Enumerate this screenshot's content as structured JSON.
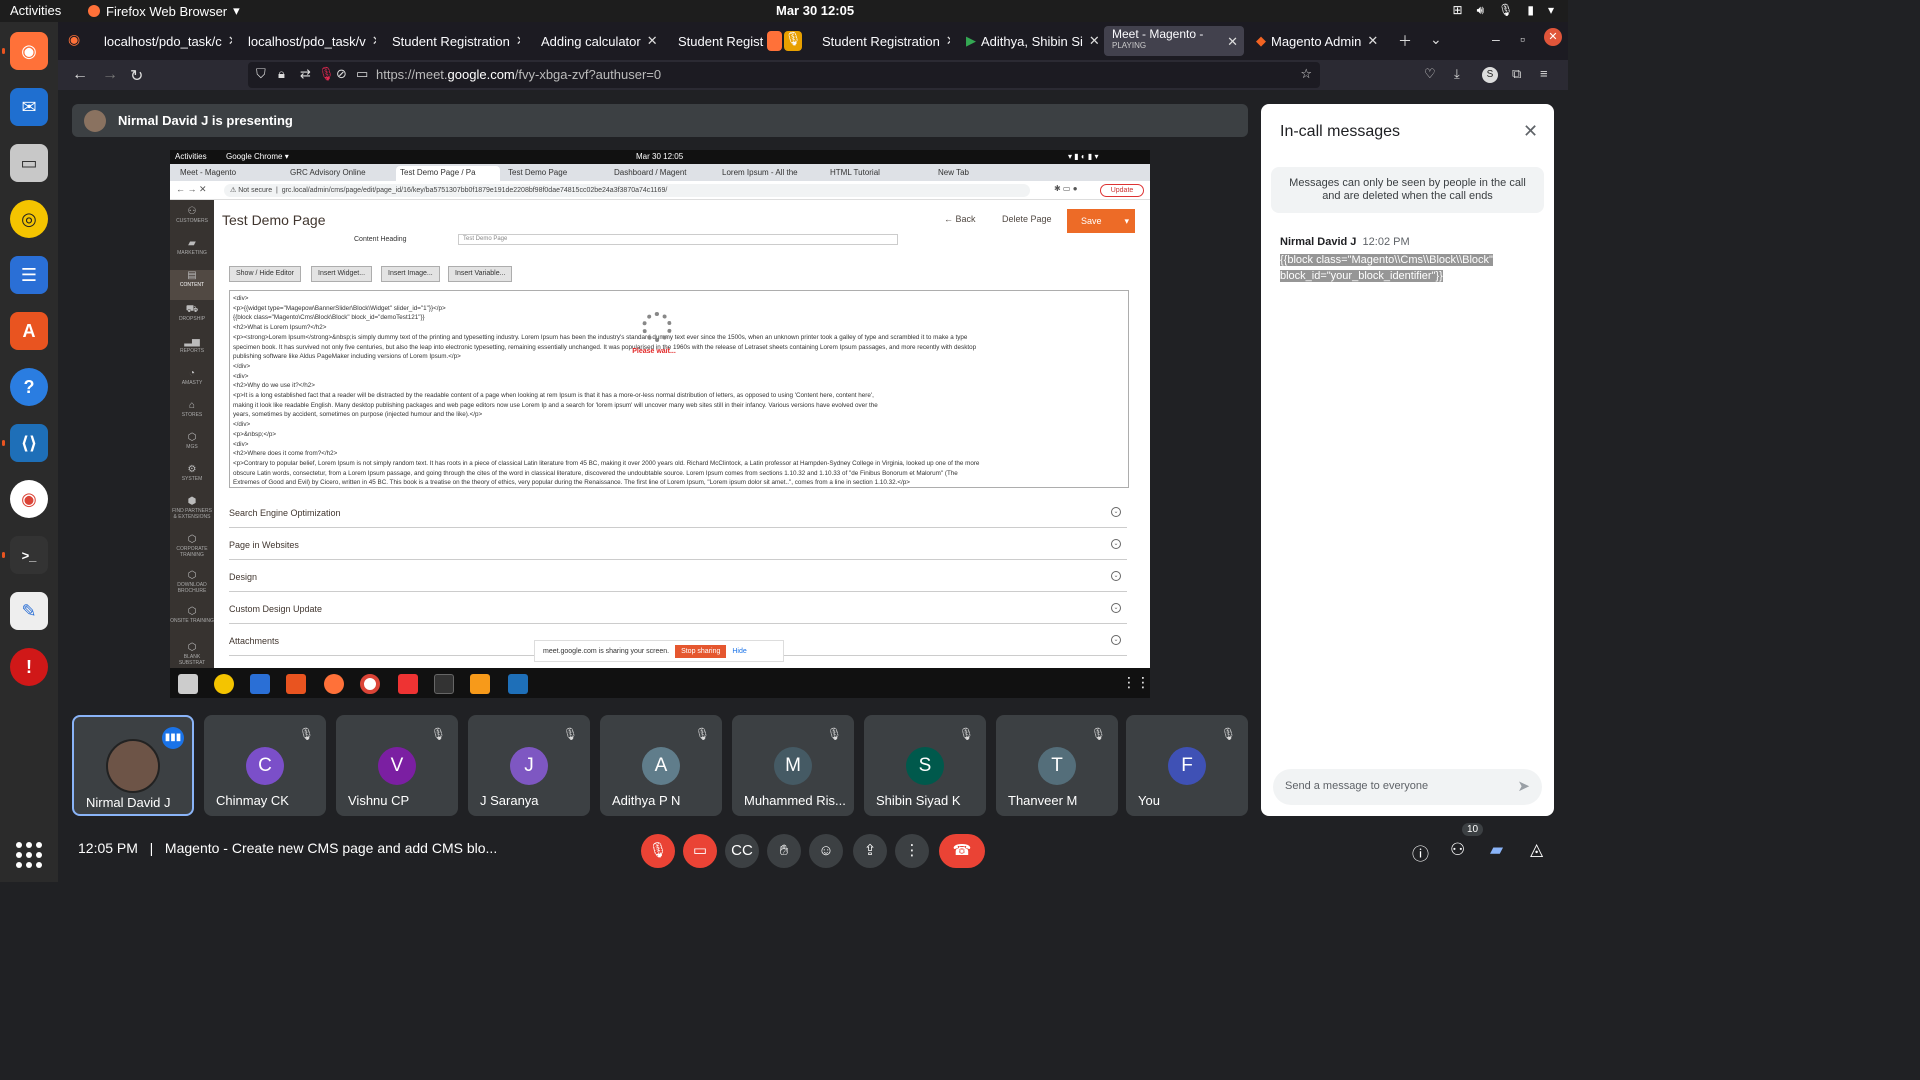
{
  "system_bar": {
    "activities": "Activities",
    "app_name": "Firefox Web Browser",
    "clock": "Mar 30  12:05"
  },
  "browser": {
    "tabs": [
      {
        "label": "localhost/pdo_task/c"
      },
      {
        "label": "localhost/pdo_task/v"
      },
      {
        "label": "Student Registration"
      },
      {
        "label": "Adding calculator"
      },
      {
        "label": "Student Regist"
      },
      {
        "label": "Student Registration"
      },
      {
        "label": "Adithya, Shibin Si"
      },
      {
        "label": "Meet - Magento -",
        "sub": "PLAYING"
      },
      {
        "label": "Magento Admin"
      }
    ],
    "url_prefix": "https://meet.",
    "url_domain": "google.com",
    "url_path": "/fvy-xbga-zvf?authuser=0"
  },
  "presenting": {
    "text": "Nirmal David J is presenting"
  },
  "shared": {
    "sys_left": "Activities",
    "sys_app": "Google Chrome ▾",
    "sys_clock": "Mar 30  12:05",
    "tabs": [
      "Meet - Magento",
      "GRC Advisory Online",
      "Test Demo Page / Pa",
      "Test Demo Page",
      "Dashboard / Magent",
      "Lorem Ipsum - All the",
      "HTML Tutorial",
      "New Tab"
    ],
    "url_not_secure": "Not secure",
    "url": "grc.local/admin/cms/page/edit/page_id/16/key/ba5751307bb0f1879e191de2208bf98f0dae74815cc02be24a3f3870a74c1169/",
    "update": "Update",
    "sidebar": [
      "CUSTOMERS",
      "MARKETING",
      "CONTENT",
      "DROPSHIP",
      "REPORTS",
      "AMASTY",
      "STORES",
      "MGS",
      "SYSTEM",
      "FIND PARTNERS & EXTENSIONS",
      "CORPORATE TRAINING",
      "DOWNLOAD BROCHURE",
      "ONSITE TRAINING",
      "BLANK SUBSTRAT"
    ],
    "page_title": "Test Demo Page",
    "back": "Back",
    "delete": "Delete Page",
    "save": "Save",
    "content_heading_label": "Content Heading",
    "content_heading_value": "Test Demo Page",
    "buttons": [
      "Show / Hide Editor",
      "Insert Widget...",
      "Insert Image...",
      "Insert Variable..."
    ],
    "code_lines": [
      "<div>",
      "<p>{{widget type=\"Magepow\\BannerSlider\\Block\\Widget\" slider_id=\"1\"}}</p>",
      "{{block class=\"Magento\\Cms\\Block\\Block\" block_id=\"demoTest121\"}}",
      "<h2>What is Lorem Ipsum?</h2>",
      "<p><strong>Lorem Ipsum</strong>&nbsp;is simply dummy text of the printing and typesetting industry. Lorem Ipsum has been the industry's standard dummy text ever since the 1500s, when an unknown printer took a galley of type and scrambled it to make a type",
      "specimen book. It has survived not only five centuries, but also the leap into electronic typesetting, remaining essentially unchanged. It was popularised in the 1960s with the release of Letraset sheets containing Lorem Ipsum passages, and more recently with desktop",
      "publishing software like Aldus PageMaker including versions of Lorem Ipsum.</p>",
      "</div>",
      "<div>",
      "<h2>Why do we use it?</h2>",
      "<p>It is a long established fact that a reader will be distracted by the readable content of a page when looking at                                                                   rem Ipsum is that it has a more-or-less normal distribution of letters, as opposed to using 'Content here, content here',",
      "making it look like readable English. Many desktop publishing packages and web page editors now use Lorem Ip                                                                      and a search for 'lorem ipsum' will uncover many web sites still in their infancy. Various versions have evolved over the",
      "years, sometimes by accident, sometimes on purpose (injected humour and the like).</p>",
      "</div>",
      "<p>&nbsp;</p>",
      "<div>",
      "<h2>Where does it come from?</h2>",
      "<p>Contrary to popular belief, Lorem Ipsum is not simply random text. It has roots in a piece of classical Latin literature from 45 BC, making it over 2000 years old. Richard McClintock, a Latin professor at Hampden-Sydney College in Virginia, looked up one of the more",
      "obscure Latin words, consectetur, from a Lorem Ipsum passage, and going through the cites of the word in classical literature, discovered the undoubtable source. Lorem Ipsum comes from sections 1.10.32 and 1.10.33 of \"de Finibus Bonorum et Malorum\" (The",
      "Extremes of Good and Evil) by Cicero, written in 45 BC. This book is a treatise on the theory of ethics, very popular during the Renaissance. The first line of Lorem Ipsum, \"Lorem ipsum dolor sit amet..\", comes from a line in section 1.10.32.</p>"
    ],
    "please_wait": "Please wait...",
    "sections": [
      "Search Engine Optimization",
      "Page in Websites",
      "Design",
      "Custom Design Update",
      "Attachments"
    ],
    "sharing_notice": "meet.google.com is sharing your screen.",
    "stop_sharing": "Stop sharing",
    "hide": "Hide"
  },
  "participants": [
    {
      "name": "Nirmal David J",
      "initial": "",
      "color": "#6d5447"
    },
    {
      "name": "Chinmay CK",
      "initial": "C",
      "color": "#7b4fc9"
    },
    {
      "name": "Vishnu CP",
      "initial": "V",
      "color": "#7b1fa2"
    },
    {
      "name": "J Saranya",
      "initial": "J",
      "color": "#7e57c2"
    },
    {
      "name": "Adithya P N",
      "initial": "A",
      "color": "#607d8b"
    },
    {
      "name": "Muhammed Ris...",
      "initial": "M",
      "color": "#455a64"
    },
    {
      "name": "Shibin Siyad K",
      "initial": "S",
      "color": "#00594c"
    },
    {
      "name": "Thanveer M",
      "initial": "T",
      "color": "#546e7a"
    },
    {
      "name": "You",
      "initial": "F",
      "color": "#3f51b5"
    }
  ],
  "panel": {
    "title": "In-call messages",
    "info": "Messages can only be seen by people in the call and are deleted when the call ends",
    "sender": "Nirmal David J",
    "time": "12:02 PM",
    "message_line1": "{{block class=\"Magento\\\\Cms\\\\Block\\\\Block\"",
    "message_line2": "block_id=\"your_block_identifier\"}}",
    "input_placeholder": "Send a message to everyone"
  },
  "bottom": {
    "time": "12:05 PM",
    "separator": "|",
    "meeting_title": "Magento - Create new CMS page and add CMS blo...",
    "people_count": "10"
  }
}
